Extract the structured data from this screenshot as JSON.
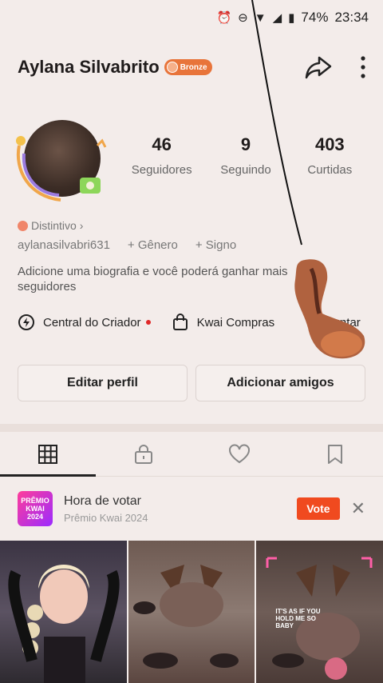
{
  "status_bar": {
    "battery": "74%",
    "time": "23:34"
  },
  "profile": {
    "name": "Aylana Silvabrito",
    "badge": "Bronze",
    "stats": [
      {
        "value": "46",
        "label": "Seguidores"
      },
      {
        "value": "9",
        "label": "Seguindo"
      },
      {
        "value": "403",
        "label": "Curtidas"
      }
    ],
    "distintivo": "Distintivo",
    "handle": "aylanasilvabri631",
    "gender": "+ Gênero",
    "sign": "+ Signo",
    "bio": "Adicione uma biografia e você poderá ganhar mais seguidores"
  },
  "links": {
    "creator": "Central do Criador",
    "shop": "Kwai Compras",
    "join": "Juntar"
  },
  "buttons": {
    "edit": "Editar perfil",
    "add_friends": "Adicionar amigos"
  },
  "vote": {
    "thumb": "PRÊMIO KWAI 2024",
    "title": "Hora de votar",
    "subtitle": "Prêmio Kwai 2024",
    "button": "Vote"
  },
  "grid": {
    "caption3": "IT'S AS IF YOU HOLD ME SO BABY"
  },
  "colors": {
    "accent": "#f04a1f",
    "badge": "#e8743a"
  }
}
